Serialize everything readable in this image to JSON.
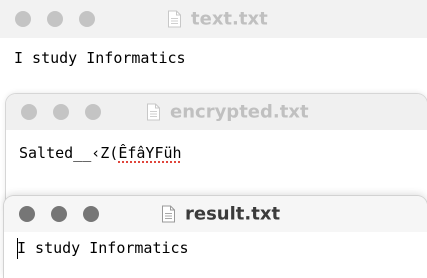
{
  "windows": {
    "text": {
      "title": "text.txt",
      "content": "I study Informatics"
    },
    "encrypted": {
      "title": "encrypted.txt",
      "content_prefix": "Salted__‹Z(",
      "content_flagged": "ÊfâYFüh"
    },
    "result": {
      "title": "result.txt",
      "content_first_char": "I",
      "content_rest": " study Informatics"
    }
  },
  "icons": {
    "window_lights": "traffic-light",
    "document": "document-icon"
  },
  "colors": {
    "inactive_title": "#c0c0c0",
    "active_title": "#3b3b3b",
    "inactive_light": "#c4c4c4",
    "active_light": "#767676",
    "spellcheck": "#e0463c"
  }
}
